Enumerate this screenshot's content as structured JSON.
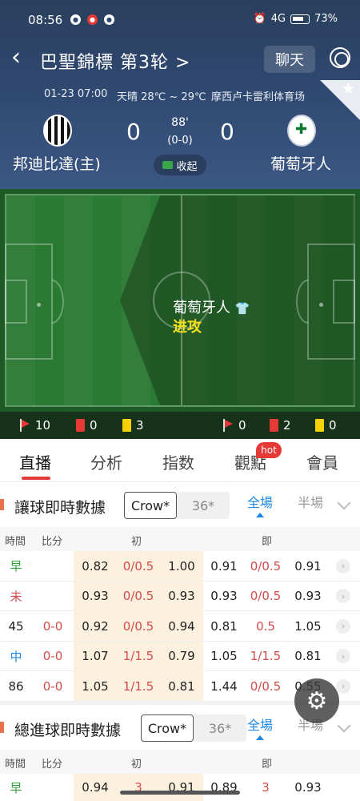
{
  "status_bar": {
    "time": "08:56",
    "signal": "4G",
    "battery": "73%"
  },
  "nav": {
    "back_icon": "chevron-left-icon",
    "title": "巴聖錦標 第3轮 >",
    "chat_label": "聊天"
  },
  "match": {
    "datetime": "01-23 07:00",
    "weather": "天晴 28℃ ~ 29℃",
    "venue": "摩西卢卡雷利体育场",
    "home_team": "邦迪比達(主)",
    "away_team": "葡萄牙人",
    "home_score": "0",
    "away_score": "0",
    "minute": "88'",
    "half_score": "(0-0)",
    "collapse_label": "收起"
  },
  "pitch": {
    "attacking_team": "葡萄牙人",
    "attack_label": "进攻"
  },
  "stats": {
    "home_corners": "10",
    "home_red": "0",
    "home_yellow": "3",
    "away_corners": "0",
    "away_red": "2",
    "away_yellow": "0"
  },
  "tabs": [
    {
      "label": "直播",
      "active": true
    },
    {
      "label": "分析"
    },
    {
      "label": "指数"
    },
    {
      "label": "觀點",
      "badge": "hot"
    },
    {
      "label": "會員"
    }
  ],
  "handicap_section": {
    "title": "讓球即時數據",
    "provider": "Crow*",
    "provider_count": "36*",
    "scope_full": "全場",
    "scope_half": "半場",
    "headers": {
      "time": "時間",
      "score": "比分",
      "initial": "初",
      "live": "即"
    },
    "rows": [
      {
        "time": "早",
        "time_color": "green",
        "score": "",
        "i1": "0.82",
        "i2": "0/0.5",
        "i3": "1.00",
        "l1": "0.91",
        "l2": "0/0.5",
        "l3": "0.91"
      },
      {
        "time": "未",
        "time_color": "red",
        "score": "",
        "i1": "0.93",
        "i2": "0/0.5",
        "i3": "0.93",
        "l1": "0.93",
        "l2": "0/0.5",
        "l3": "0.93"
      },
      {
        "time": "45",
        "time_color": "dark",
        "score": "0-0",
        "i1": "0.92",
        "i2": "0/0.5",
        "i3": "0.94",
        "l1": "0.81",
        "l2": "0.5",
        "l3": "1.05"
      },
      {
        "time": "中",
        "time_color": "blue",
        "score": "0-0",
        "i1": "1.07",
        "i2": "1/1.5",
        "i3": "0.79",
        "l1": "1.05",
        "l2": "1/1.5",
        "l3": "0.81"
      },
      {
        "time": "86",
        "time_color": "dark",
        "score": "0-0",
        "i1": "1.05",
        "i2": "1/1.5",
        "i3": "0.81",
        "l1": "1.44",
        "l2": "0/0.5",
        "l3": "0.55"
      }
    ]
  },
  "totals_section": {
    "title": "總進球即時數據",
    "provider": "Crow*",
    "provider_count": "36*",
    "scope_full": "全場",
    "scope_half": "半場",
    "headers": {
      "time": "時間",
      "score": "比分",
      "initial": "初",
      "live": "即"
    },
    "partial_row": {
      "time": "早",
      "i1": "0.94",
      "i2": "3",
      "i3": "0.91",
      "l1": "0.89",
      "l2": "3",
      "l3": "0.93"
    }
  },
  "colors": {
    "accent": "#e53935",
    "link_blue": "#1e88e5",
    "header_bg": "#2f4870",
    "odds_bg": "#fcf1de"
  }
}
